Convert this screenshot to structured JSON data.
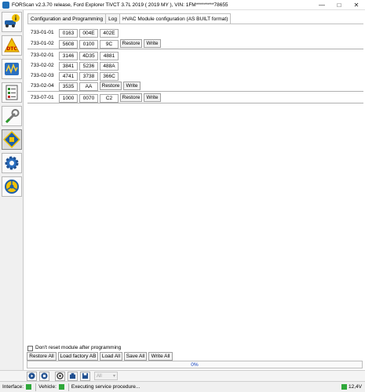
{
  "window": {
    "title": "FORScan v2.3.70 release, Ford Explorer TiVCT 3.7L 2019 ( 2019 MY ), VIN: 1FM*********78655"
  },
  "sidebar": {
    "items": [
      {
        "icon": "info-car-icon"
      },
      {
        "icon": "dtc-icon"
      },
      {
        "icon": "oscilloscope-icon"
      },
      {
        "icon": "checklist-icon"
      },
      {
        "icon": "wrench-icon"
      },
      {
        "icon": "chip-icon"
      },
      {
        "icon": "gear-icon"
      },
      {
        "icon": "steering-wheel-icon"
      }
    ]
  },
  "tabs": [
    {
      "label": "Configuration and Programming"
    },
    {
      "label": "Log"
    },
    {
      "label": "HVAC Module configuration (AS BUILT format)"
    }
  ],
  "rows": [
    {
      "label": "733-01-01",
      "cells": [
        "0163",
        "004E",
        "402E"
      ],
      "restore": "",
      "write": ""
    },
    {
      "label": "733-01-02",
      "cells": [
        "5608",
        "0100",
        "9C"
      ],
      "restore": "Restore",
      "write": "Write"
    },
    {
      "label": "733-02-01",
      "cells": [
        "3146",
        "4D35",
        "4881"
      ],
      "restore": "",
      "write": ""
    },
    {
      "label": "733-02-02",
      "cells": [
        "3841",
        "5236",
        "488A"
      ],
      "restore": "",
      "write": ""
    },
    {
      "label": "733-02-03",
      "cells": [
        "4741",
        "3738",
        "366C"
      ],
      "restore": "",
      "write": ""
    },
    {
      "label": "733-02-04",
      "cells": [
        "3535",
        "AA"
      ],
      "restore": "Restore",
      "write": "Write"
    },
    {
      "label": "733-07-01",
      "cells": [
        "1000",
        "0070",
        "C2"
      ],
      "restore": "Restore",
      "write": "Write"
    }
  ],
  "bottom": {
    "checkbox_label": "Don't reset module after programming",
    "buttons": {
      "restore_all": "Restore All",
      "load_factory": "Load factory AB",
      "load_all": "Load All",
      "save_all": "Save All",
      "write_all": "Write All"
    },
    "progress": {
      "value": 0,
      "text": "0%"
    }
  },
  "toolbar": {
    "select_value": "All"
  },
  "status": {
    "interface_label": "Interface:",
    "vehicle_label": "Vehicle:",
    "message": "Executing service procedure...",
    "voltage": "12,4V"
  },
  "colors": {
    "status_green": "#2fa83a",
    "progress_text": "#1040c0"
  }
}
